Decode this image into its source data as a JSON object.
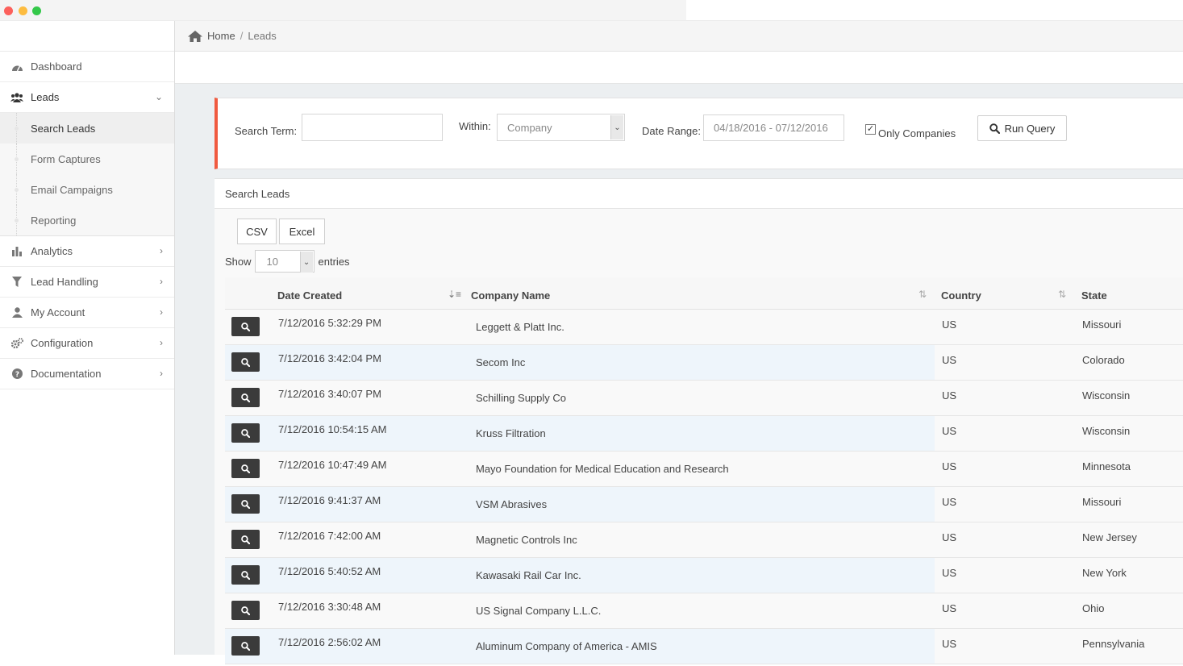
{
  "window": {
    "controls": [
      "close",
      "minimize",
      "zoom"
    ]
  },
  "breadcrumb": {
    "home": "Home",
    "separator": "/",
    "current": "Leads"
  },
  "sidebar": {
    "items": [
      {
        "label": "Dashboard",
        "icon": "dashboard-icon"
      },
      {
        "label": "Leads",
        "icon": "users-icon",
        "expanded": true
      },
      {
        "label": "Analytics",
        "icon": "bar-chart-icon"
      },
      {
        "label": "Lead Handling",
        "icon": "filter-icon"
      },
      {
        "label": "My Account",
        "icon": "user-icon"
      },
      {
        "label": "Configuration",
        "icon": "gears-icon"
      },
      {
        "label": "Documentation",
        "icon": "question-circle-icon"
      }
    ],
    "leads_sub": [
      "Search Leads",
      "Form Captures",
      "Email Campaigns",
      "Reporting"
    ],
    "current_sub": "Search Leads"
  },
  "query": {
    "search_label": "Search Term:",
    "search_value": "",
    "within_label": "Within:",
    "within_value": "Company",
    "date_label": "Date Range:",
    "date_value": "04/18/2016 - 07/12/2016",
    "only_companies_label": "Only Companies",
    "only_companies_checked": true,
    "run_label": "Run Query",
    "accent_color": "#f05a40"
  },
  "results": {
    "title": "Search Leads",
    "export": {
      "csv": "CSV",
      "excel": "Excel"
    },
    "show_label": "Show",
    "page_length": "10",
    "entries_label": "entries",
    "columns": [
      "Date Created",
      "Company Name",
      "Country",
      "State"
    ],
    "rows": [
      {
        "date": "7/12/2016 5:32:29 PM",
        "company": "Leggett & Platt Inc.",
        "country": "US",
        "state": "Missouri"
      },
      {
        "date": "7/12/2016 3:42:04 PM",
        "company": "Secom Inc",
        "country": "US",
        "state": "Colorado"
      },
      {
        "date": "7/12/2016 3:40:07 PM",
        "company": "Schilling Supply Co",
        "country": "US",
        "state": "Wisconsin"
      },
      {
        "date": "7/12/2016 10:54:15 AM",
        "company": "Kruss Filtration",
        "country": "US",
        "state": "Wisconsin"
      },
      {
        "date": "7/12/2016 10:47:49 AM",
        "company": "Mayo Foundation for Medical Education and Research",
        "country": "US",
        "state": "Minnesota"
      },
      {
        "date": "7/12/2016 9:41:37 AM",
        "company": "VSM Abrasives",
        "country": "US",
        "state": "Missouri"
      },
      {
        "date": "7/12/2016 7:42:00 AM",
        "company": "Magnetic Controls Inc",
        "country": "US",
        "state": "New Jersey"
      },
      {
        "date": "7/12/2016 5:40:52 AM",
        "company": "Kawasaki Rail Car Inc.",
        "country": "US",
        "state": "New York"
      },
      {
        "date": "7/12/2016 3:30:48 AM",
        "company": "US Signal Company L.L.C.",
        "country": "US",
        "state": "Ohio"
      },
      {
        "date": "7/12/2016 2:56:02 AM",
        "company": "Aluminum Company of America - AMIS",
        "country": "US",
        "state": "Pennsylvania"
      }
    ]
  }
}
